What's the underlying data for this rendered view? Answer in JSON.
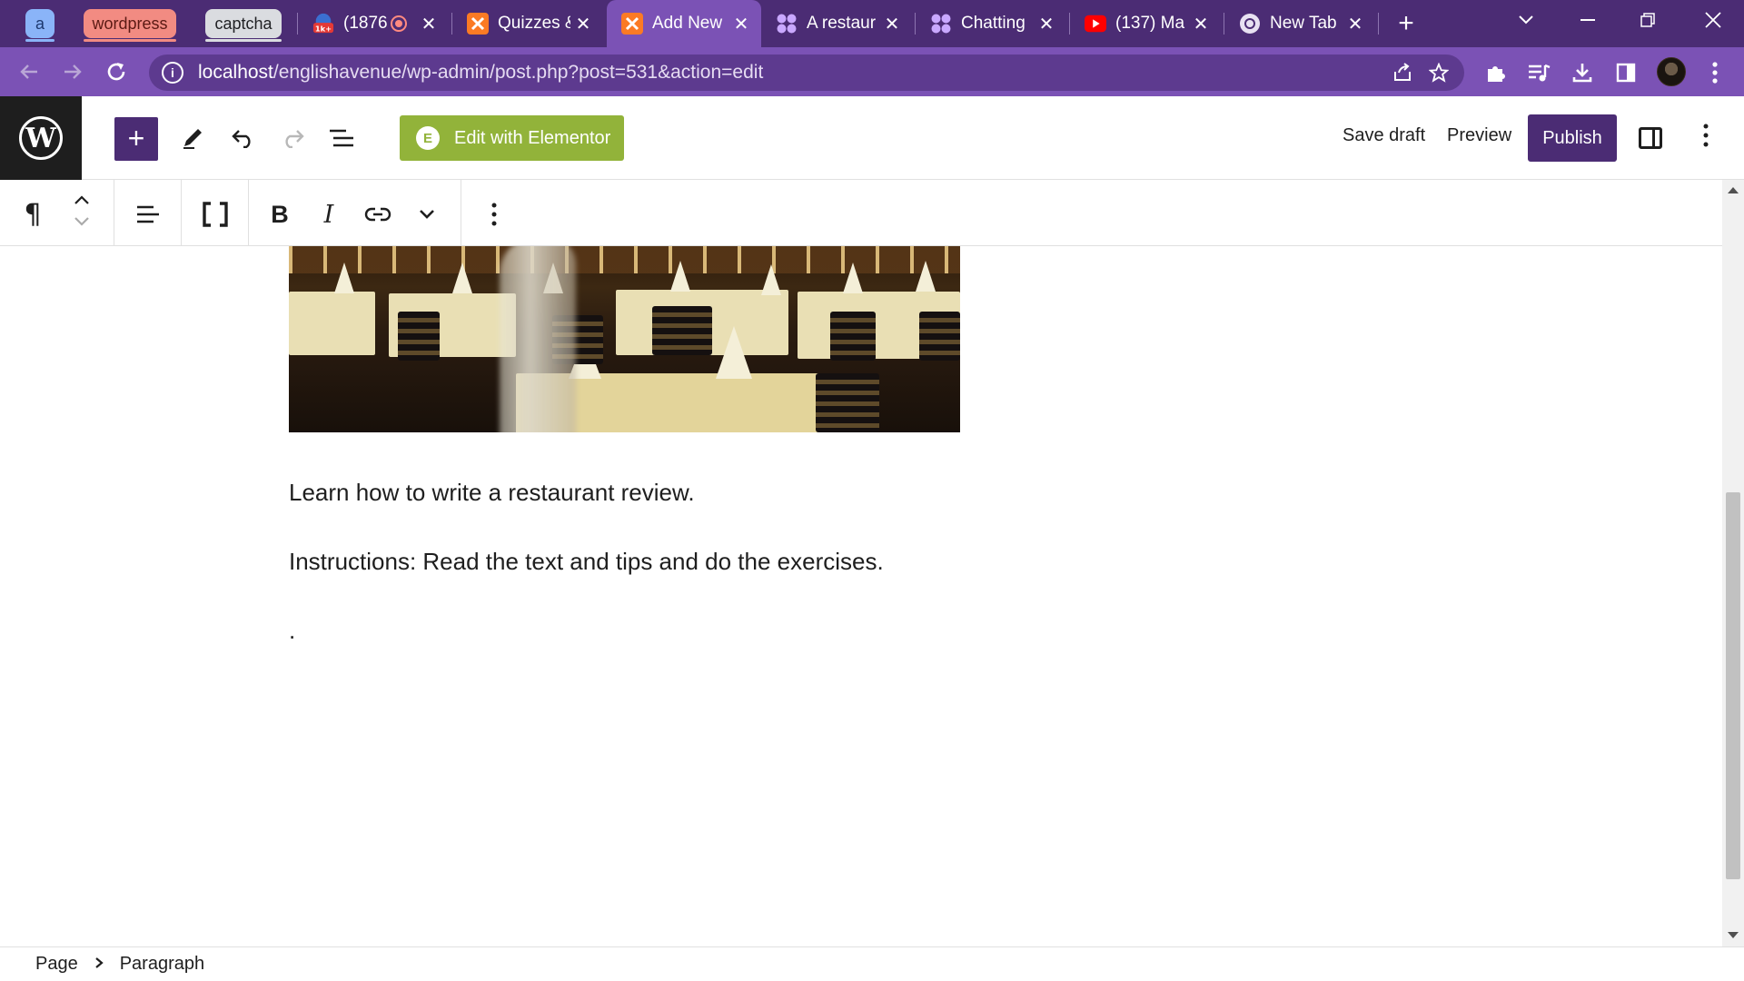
{
  "browser": {
    "groups": [
      {
        "label": "a",
        "color": "#8ab4f8",
        "text_color": "#1e3a70"
      },
      {
        "label": "wordpress",
        "color": "#f28b82",
        "text_color": "#5c1a14"
      },
      {
        "label": "captcha",
        "color": "#dadce0",
        "text_color": "#202124"
      }
    ],
    "tabs": [
      {
        "label": "(1876",
        "icon": "notification-badge-icon",
        "badge": "1k+",
        "recording": true,
        "active": false
      },
      {
        "label": "Quizzes &",
        "icon": "xampp-icon",
        "active": false
      },
      {
        "label": "Add New",
        "icon": "xampp-icon",
        "active": true
      },
      {
        "label": "A restaur",
        "icon": "app-grid-icon",
        "active": false
      },
      {
        "label": "Chatting",
        "icon": "app-grid-icon",
        "active": false
      },
      {
        "label": "(137) Ma",
        "icon": "youtube-icon",
        "active": false
      },
      {
        "label": "New Tab",
        "icon": "chrome-icon",
        "active": false
      }
    ],
    "url_host": "localhost",
    "url_path": "/englishavenue/wp-admin/post.php?post=531&action=edit",
    "theme_color": "#7b52b5"
  },
  "editor": {
    "elementor_label": "Edit with Elementor",
    "save_draft_label": "Save draft",
    "preview_label": "Preview",
    "publish_label": "Publish",
    "accent_color": "#4b2c74",
    "elementor_color": "#92b33a"
  },
  "content": {
    "paragraphs": [
      "Learn how to write a restaurant review.",
      "Instructions: Read the text and tips and do the exercises.",
      "."
    ]
  },
  "breadcrumb": {
    "items": [
      "Page",
      "Paragraph"
    ]
  }
}
